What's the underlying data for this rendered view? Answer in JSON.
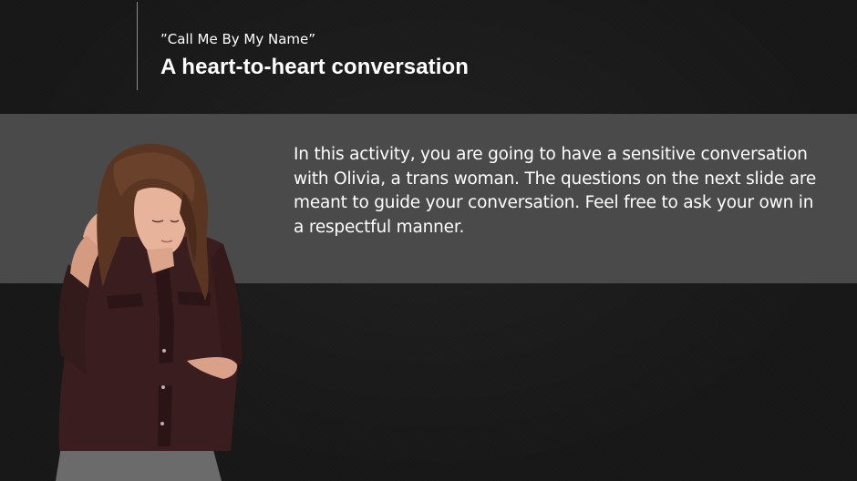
{
  "slide": {
    "subtitle": "”Call Me By My Name”",
    "title": "A heart-to-heart conversation",
    "body": "In this activity, you are going to have a sensitive conversation with Olivia, a trans woman. The questions on the next slide are meant to guide your conversation. Feel free to ask your own in a respectful manner."
  },
  "colors": {
    "background": "#171717",
    "band": "#4a4a4a",
    "text": "#ffffff",
    "divider": "#8a8a8a",
    "shirt": "#3a1e1f",
    "hair": "#5a3622"
  },
  "icons": {
    "person": "woman-thinking-illustration"
  }
}
